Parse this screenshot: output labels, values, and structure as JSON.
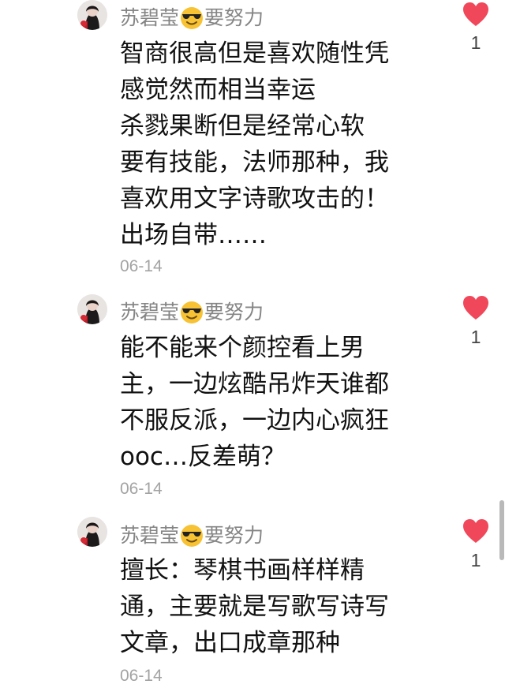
{
  "comments": [
    {
      "username_pre": "苏碧莹",
      "emoji": "smiling-face-with-sunglasses",
      "username_post": "要努力",
      "lines": [
        "智商很高但是喜欢随性凭",
        "感觉然而相当幸运",
        "杀戮果断但是经常心软",
        "要有技能，法师那种，我",
        "喜欢用文字诗歌攻击的！",
        "出场自带……"
      ],
      "date": "06-14",
      "likes": "1"
    },
    {
      "username_pre": "苏碧莹",
      "emoji": "smiling-face-with-sunglasses",
      "username_post": "要努力",
      "lines": [
        "能不能来个颜控看上男",
        "主，一边炫酷吊炸天谁都",
        "不服反派，一边内心疯狂",
        "ooc…反差萌？"
      ],
      "date": "06-14",
      "likes": "1"
    },
    {
      "username_pre": "苏碧莹",
      "emoji": "smiling-face-with-sunglasses",
      "username_post": "要努力",
      "lines": [
        "擅长：琴棋书画样样精",
        "通，主要就是写歌写诗写",
        "文章，出口成章那种"
      ],
      "date": "06-14",
      "likes": "1"
    }
  ],
  "colors": {
    "heart": "#f0475a",
    "username": "#858585",
    "text": "#111111",
    "date": "#a3a3a3"
  }
}
